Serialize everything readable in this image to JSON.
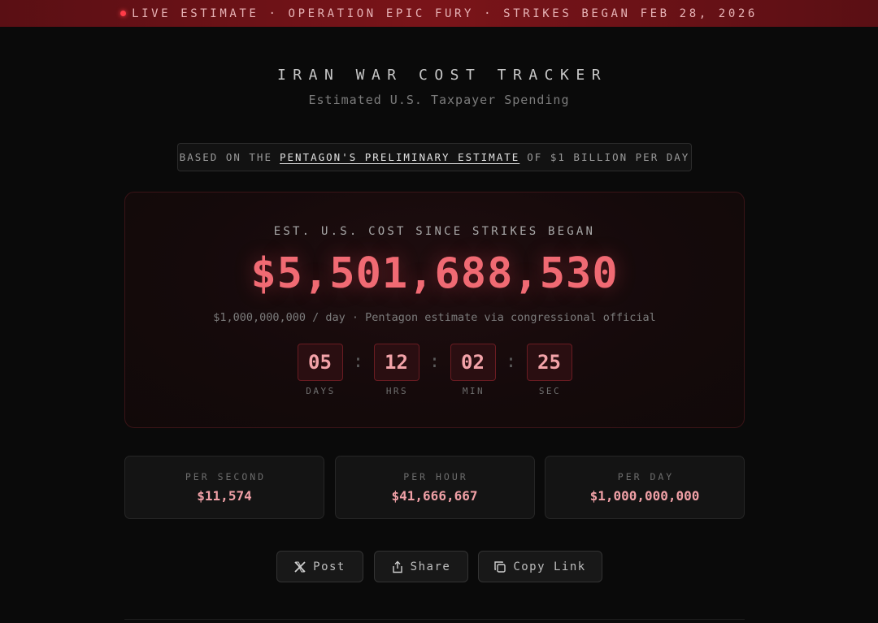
{
  "banner": {
    "text": "LIVE ESTIMATE · OPERATION EPIC FURY · STRIKES BEGAN FEB 28, 2026",
    "live_color": "#ff3b47"
  },
  "header": {
    "title": "IRAN WAR COST TRACKER",
    "subtitle": "Estimated U.S. Taxpayer Spending"
  },
  "basis": {
    "prefix": "BASED ON THE",
    "link": "PENTAGON'S PRELIMINARY ESTIMATE",
    "suffix": "OF $1 BILLION PER DAY"
  },
  "counter": {
    "label": "EST. U.S. COST SINCE STRIKES BEGAN",
    "amount": "$5,501,688,530",
    "note": "$1,000,000,000 / day · Pentagon estimate via congressional official",
    "timer": [
      {
        "value": "05",
        "label": "DAYS"
      },
      {
        "value": "12",
        "label": "HRS"
      },
      {
        "value": "02",
        "label": "MIN"
      },
      {
        "value": "25",
        "label": "SEC"
      }
    ],
    "separator": ":"
  },
  "stats": [
    {
      "label": "PER SECOND",
      "value": "$11,574"
    },
    {
      "label": "PER HOUR",
      "value": "$41,666,667"
    },
    {
      "label": "PER DAY",
      "value": "$1,000,000,000"
    }
  ],
  "actions": {
    "post": {
      "label": "Post",
      "icon": "x-logo-icon"
    },
    "share": {
      "label": "Share",
      "icon": "share-icon"
    },
    "copy": {
      "label": "Copy Link",
      "icon": "copy-icon"
    }
  },
  "colors": {
    "accent": "#f06a73",
    "banner_bg": "#7a1419",
    "background": "#0a0a0a"
  }
}
